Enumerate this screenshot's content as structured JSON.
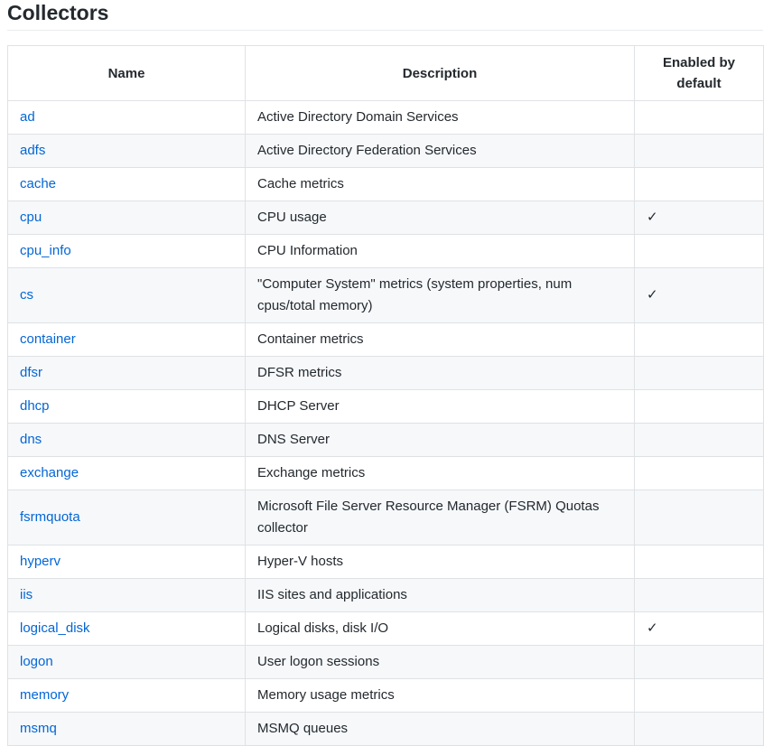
{
  "heading": "Collectors",
  "table": {
    "headers": [
      "Name",
      "Description",
      "Enabled by default"
    ],
    "rows": [
      {
        "name": "ad",
        "description": "Active Directory Domain Services",
        "enabled": ""
      },
      {
        "name": "adfs",
        "description": "Active Directory Federation Services",
        "enabled": ""
      },
      {
        "name": "cache",
        "description": "Cache metrics",
        "enabled": ""
      },
      {
        "name": "cpu",
        "description": "CPU usage",
        "enabled": "✓"
      },
      {
        "name": "cpu_info",
        "description": "CPU Information",
        "enabled": ""
      },
      {
        "name": "cs",
        "description": "\"Computer System\" metrics (system properties, num cpus/total memory)",
        "enabled": "✓"
      },
      {
        "name": "container",
        "description": "Container metrics",
        "enabled": ""
      },
      {
        "name": "dfsr",
        "description": "DFSR metrics",
        "enabled": ""
      },
      {
        "name": "dhcp",
        "description": "DHCP Server",
        "enabled": ""
      },
      {
        "name": "dns",
        "description": "DNS Server",
        "enabled": ""
      },
      {
        "name": "exchange",
        "description": "Exchange metrics",
        "enabled": ""
      },
      {
        "name": "fsrmquota",
        "description": "Microsoft File Server Resource Manager (FSRM) Quotas collector",
        "enabled": ""
      },
      {
        "name": "hyperv",
        "description": "Hyper-V hosts",
        "enabled": ""
      },
      {
        "name": "iis",
        "description": "IIS sites and applications",
        "enabled": ""
      },
      {
        "name": "logical_disk",
        "description": "Logical disks, disk I/O",
        "enabled": "✓"
      },
      {
        "name": "logon",
        "description": "User logon sessions",
        "enabled": ""
      },
      {
        "name": "memory",
        "description": "Memory usage metrics",
        "enabled": ""
      },
      {
        "name": "msmq",
        "description": "MSMQ queues",
        "enabled": ""
      }
    ]
  }
}
